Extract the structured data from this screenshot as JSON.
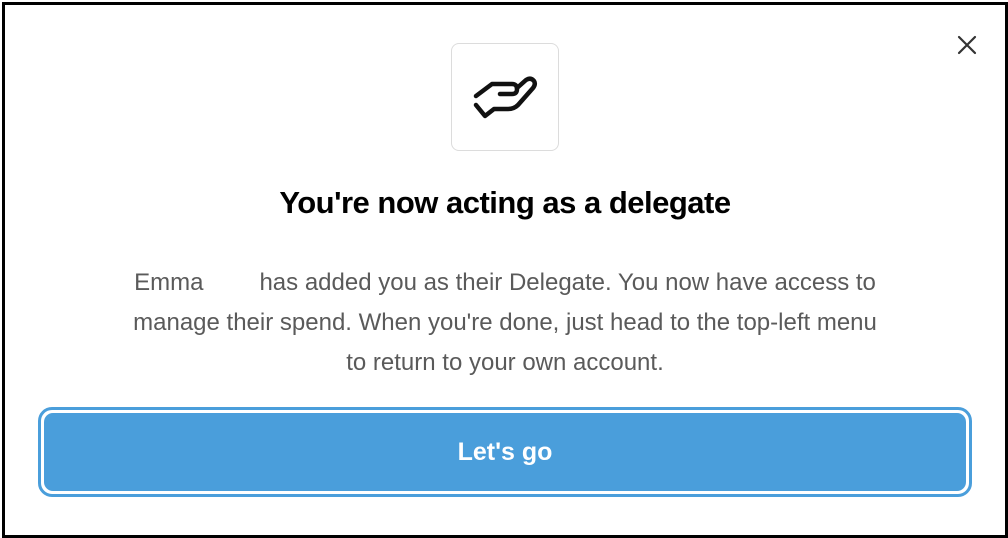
{
  "dialog": {
    "title": "You're now acting as a delegate",
    "body": {
      "name": "Emma",
      "line1_rest": "has added you as their Delegate. You now have access to",
      "line2": "manage their spend. When you're done, just head to the top-left menu",
      "line3": "to return to your own account."
    },
    "cta_label": "Let's go",
    "icons": {
      "close": "close-icon",
      "hero": "helping-hand-icon"
    }
  },
  "colors": {
    "accent": "#4a9edb",
    "title": "#000000",
    "body": "#5a5a5a",
    "tile_border": "#dcdcdc"
  }
}
